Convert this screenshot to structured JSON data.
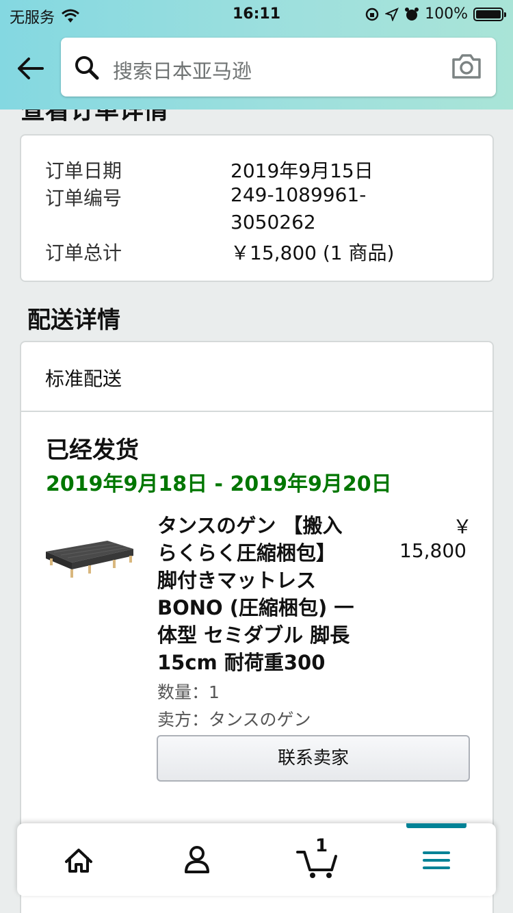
{
  "status_bar": {
    "carrier": "无服务",
    "time": "16:11",
    "battery": "100%"
  },
  "search": {
    "placeholder": "搜索日本亚马逊"
  },
  "page": {
    "heading_cut": "查看订单详情"
  },
  "order_summary": {
    "rows": [
      {
        "label": "订单日期",
        "value": "2019年9月15日"
      },
      {
        "label": "订单编号",
        "value_line1": "249-1089961-",
        "value_line2": "3050262"
      },
      {
        "label": "订单总计",
        "value": "￥15,800 (1 商品)"
      }
    ]
  },
  "shipping": {
    "section_title": "配送详情",
    "method": "标准配送",
    "status": "已经发货",
    "delivery_range": "2019年9月18日 - 2019年9月20日",
    "item": {
      "title_lines": [
        "タンスのゲン 【搬入",
        "らくらく圧縮梱包】",
        "脚付きマットレス",
        "BONO (圧縮梱包) 一",
        "体型 セミダブル 脚長",
        "15cm 耐荷重300"
      ],
      "price_symbol": "￥",
      "price": "15,800",
      "quantity": "数量：1",
      "seller": "卖方：タンスのゲン",
      "contact_button": "联系卖家"
    }
  },
  "bottom_nav": {
    "cart_count": "1",
    "accent_color": "#008296"
  },
  "colors": {
    "header_gradient_start": "#84d8e1",
    "header_gradient_end": "#a9e4d7",
    "delivery_green": "#007600"
  }
}
